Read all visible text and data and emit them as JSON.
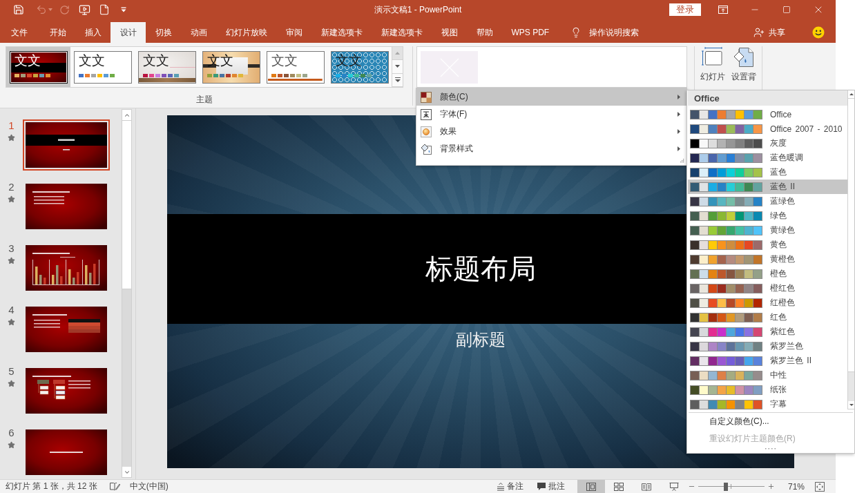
{
  "title_bar": {
    "quick_access": [
      {
        "kind": "save",
        "disabled": false
      },
      {
        "kind": "undo",
        "disabled": true
      },
      {
        "kind": "redo",
        "disabled": true
      },
      {
        "kind": "present",
        "disabled": false
      },
      {
        "kind": "new",
        "disabled": false
      },
      {
        "kind": "customize",
        "disabled": false
      }
    ],
    "title": "演示文稿1 - PowerPoint",
    "sign_in": "登录"
  },
  "ribbon_tabs": [
    {
      "label": "文件",
      "selected": false
    },
    {
      "label": "开始",
      "selected": false
    },
    {
      "label": "插入",
      "selected": false
    },
    {
      "label": "设计",
      "selected": true
    },
    {
      "label": "切换",
      "selected": false
    },
    {
      "label": "动画",
      "selected": false
    },
    {
      "label": "幻灯片放映",
      "selected": false
    },
    {
      "label": "审阅",
      "selected": false
    },
    {
      "label": "新建选项卡",
      "selected": false
    },
    {
      "label": "新建选项卡",
      "selected": false
    },
    {
      "label": "视图",
      "selected": false
    },
    {
      "label": "帮助",
      "selected": false
    },
    {
      "label": "WPS PDF",
      "selected": false
    }
  ],
  "tell_me": "操作说明搜索",
  "share": "共享",
  "ribbon": {
    "themes": {
      "items": [
        {
          "kind": "red-band",
          "sample": "文文",
          "selected": true,
          "swatches": [
            {
              "color": "#e5b35c"
            },
            {
              "color": "#a39c7c"
            },
            {
              "color": "#d9482c"
            },
            {
              "color": "#c7a53e"
            },
            {
              "color": "#6b9baf"
            },
            {
              "color": "#e38f31"
            }
          ]
        },
        {
          "kind": "office",
          "sample": "文文",
          "selected": false,
          "swatches": [
            {
              "color": "#4472c4"
            },
            {
              "color": "#ed7d31"
            },
            {
              "color": "#a5a5a5"
            },
            {
              "color": "#ffc000"
            },
            {
              "color": "#5b9bd5"
            },
            {
              "color": "#70ad47"
            }
          ]
        },
        {
          "kind": "paper",
          "sample": "文文",
          "selected": false,
          "swatches": [
            {
              "color": "#b8133e"
            },
            {
              "color": "#e2458c"
            },
            {
              "color": "#c77ce0"
            },
            {
              "color": "#7f4fb7"
            },
            {
              "color": "#5b66b7"
            },
            {
              "color": "#599fb4"
            }
          ]
        },
        {
          "kind": "wood",
          "sample": "文文",
          "selected": false,
          "swatches": [
            {
              "color": "#94a23a"
            },
            {
              "color": "#3a9a78"
            },
            {
              "color": "#4872a2"
            },
            {
              "color": "#b23a2e"
            },
            {
              "color": "#e0852f"
            },
            {
              "color": "#e0b83a"
            }
          ]
        },
        {
          "kind": "plain-bar",
          "sample": "文文",
          "selected": false,
          "swatches": [
            {
              "color": "#e07a14"
            },
            {
              "color": "#bf562b"
            },
            {
              "color": "#8b5439"
            },
            {
              "color": "#a08b5e"
            },
            {
              "color": "#c4bf86"
            },
            {
              "color": "#9ca68c"
            }
          ]
        },
        {
          "kind": "pattern",
          "sample": "文文",
          "selected": false,
          "swatches": [
            {
              "color": "#1cade4"
            },
            {
              "color": "#2683c6"
            },
            {
              "color": "#27ced7"
            },
            {
              "color": "#42ba97"
            },
            {
              "color": "#3e8853"
            },
            {
              "color": "#62a39f"
            }
          ]
        }
      ],
      "label": "主题"
    },
    "customize": [
      {
        "kind": "slide-size",
        "label": "幻灯片"
      },
      {
        "kind": "format-background",
        "label": "设置背"
      }
    ]
  },
  "variants_menu": [
    {
      "kind": "colors",
      "label": "颜色(C)",
      "selected": true
    },
    {
      "kind": "fonts",
      "label": "字体(F)",
      "selected": false
    },
    {
      "kind": "effects",
      "label": "效果",
      "selected": false
    },
    {
      "kind": "background",
      "label": "背景样式",
      "selected": false
    }
  ],
  "color_schemes": {
    "header": "Office",
    "items": [
      {
        "name": "Office",
        "selected": false,
        "swatches": [
          {
            "color": "#44546a"
          },
          {
            "color": "#e7e6e6"
          },
          {
            "color": "#4472c4"
          },
          {
            "color": "#ed7d31"
          },
          {
            "color": "#a5a5a5"
          },
          {
            "color": "#ffc000"
          },
          {
            "color": "#5b9bd5"
          },
          {
            "color": "#70ad47"
          }
        ]
      },
      {
        "name": "Office 2007 - 2010",
        "selected": false,
        "swatches": [
          {
            "color": "#1f497d"
          },
          {
            "color": "#eeece1"
          },
          {
            "color": "#4f81bd"
          },
          {
            "color": "#c0504d"
          },
          {
            "color": "#9bbb59"
          },
          {
            "color": "#8064a2"
          },
          {
            "color": "#4bacc6"
          },
          {
            "color": "#f79646"
          }
        ]
      },
      {
        "name": "灰度",
        "selected": false,
        "swatches": [
          {
            "color": "#000000"
          },
          {
            "color": "#f8f8f8"
          },
          {
            "color": "#dddddd"
          },
          {
            "color": "#b2b2b2"
          },
          {
            "color": "#969696"
          },
          {
            "color": "#808080"
          },
          {
            "color": "#5f5f5f"
          },
          {
            "color": "#4d4d4d"
          }
        ]
      },
      {
        "name": "蓝色暖调",
        "selected": false,
        "swatches": [
          {
            "color": "#242852"
          },
          {
            "color": "#acccea"
          },
          {
            "color": "#4a66ac"
          },
          {
            "color": "#629dd1"
          },
          {
            "color": "#297fd5"
          },
          {
            "color": "#7f8fa9"
          },
          {
            "color": "#5aa2ae"
          },
          {
            "color": "#9d90a0"
          }
        ]
      },
      {
        "name": "蓝色",
        "selected": false,
        "swatches": [
          {
            "color": "#17406d"
          },
          {
            "color": "#dbeff9"
          },
          {
            "color": "#0f6fc6"
          },
          {
            "color": "#009dd9"
          },
          {
            "color": "#0bd0d9"
          },
          {
            "color": "#10cf9b"
          },
          {
            "color": "#7cca62"
          },
          {
            "color": "#a5c249"
          }
        ]
      },
      {
        "name": "蓝色 II",
        "selected": true,
        "swatches": [
          {
            "color": "#335b74"
          },
          {
            "color": "#dfe3e5"
          },
          {
            "color": "#1cade4"
          },
          {
            "color": "#2683c6"
          },
          {
            "color": "#27ced7"
          },
          {
            "color": "#42ba97"
          },
          {
            "color": "#3e8853"
          },
          {
            "color": "#62a39f"
          }
        ]
      },
      {
        "name": "蓝绿色",
        "selected": false,
        "swatches": [
          {
            "color": "#373545"
          },
          {
            "color": "#cedbe6"
          },
          {
            "color": "#3494ba"
          },
          {
            "color": "#58b6c0"
          },
          {
            "color": "#75bda7"
          },
          {
            "color": "#7a8c8e"
          },
          {
            "color": "#84acb6"
          },
          {
            "color": "#2683c6"
          }
        ]
      },
      {
        "name": "绿色",
        "selected": false,
        "swatches": [
          {
            "color": "#455f51"
          },
          {
            "color": "#e3ded1"
          },
          {
            "color": "#549e39"
          },
          {
            "color": "#8ab833"
          },
          {
            "color": "#c0cf3a"
          },
          {
            "color": "#029676"
          },
          {
            "color": "#4ab5c4"
          },
          {
            "color": "#0989b1"
          }
        ]
      },
      {
        "name": "黄绿色",
        "selected": false,
        "swatches": [
          {
            "color": "#455f51"
          },
          {
            "color": "#e3ded1"
          },
          {
            "color": "#99cb38"
          },
          {
            "color": "#63a537"
          },
          {
            "color": "#37a76f"
          },
          {
            "color": "#44c1a3"
          },
          {
            "color": "#4eb3cf"
          },
          {
            "color": "#51c3f9"
          }
        ]
      },
      {
        "name": "黄色",
        "selected": false,
        "swatches": [
          {
            "color": "#39302a"
          },
          {
            "color": "#e5dedb"
          },
          {
            "color": "#ffca08"
          },
          {
            "color": "#f8931d"
          },
          {
            "color": "#ce8d3e"
          },
          {
            "color": "#ec7016"
          },
          {
            "color": "#e64823"
          },
          {
            "color": "#9c6a6a"
          }
        ]
      },
      {
        "name": "黄橙色",
        "selected": false,
        "swatches": [
          {
            "color": "#4e3b30"
          },
          {
            "color": "#fbeec9"
          },
          {
            "color": "#f0a22e"
          },
          {
            "color": "#a5644e"
          },
          {
            "color": "#b58b80"
          },
          {
            "color": "#c3986d"
          },
          {
            "color": "#a19574"
          },
          {
            "color": "#c17529"
          }
        ]
      },
      {
        "name": "橙色",
        "selected": false,
        "swatches": [
          {
            "color": "#637052"
          },
          {
            "color": "#ccddea"
          },
          {
            "color": "#e48312"
          },
          {
            "color": "#bd582c"
          },
          {
            "color": "#865640"
          },
          {
            "color": "#9b8357"
          },
          {
            "color": "#c2bc80"
          },
          {
            "color": "#94a088"
          }
        ]
      },
      {
        "name": "橙红色",
        "selected": false,
        "swatches": [
          {
            "color": "#696464"
          },
          {
            "color": "#e9e5dc"
          },
          {
            "color": "#d34817"
          },
          {
            "color": "#9b2d1f"
          },
          {
            "color": "#a28e6a"
          },
          {
            "color": "#956251"
          },
          {
            "color": "#918485"
          },
          {
            "color": "#855d5d"
          }
        ]
      },
      {
        "name": "红橙色",
        "selected": false,
        "swatches": [
          {
            "color": "#505046"
          },
          {
            "color": "#eeece1"
          },
          {
            "color": "#e84c22"
          },
          {
            "color": "#ffbd47"
          },
          {
            "color": "#b64926"
          },
          {
            "color": "#ff8427"
          },
          {
            "color": "#cc9900"
          },
          {
            "color": "#b22600"
          }
        ]
      },
      {
        "name": "红色",
        "selected": false,
        "swatches": [
          {
            "color": "#323232"
          },
          {
            "color": "#e5c243"
          },
          {
            "color": "#a5300f"
          },
          {
            "color": "#d55816"
          },
          {
            "color": "#e19825"
          },
          {
            "color": "#b19c7d"
          },
          {
            "color": "#7f5f52"
          },
          {
            "color": "#b27d49"
          }
        ]
      },
      {
        "name": "紫红色",
        "selected": false,
        "swatches": [
          {
            "color": "#454551"
          },
          {
            "color": "#d8d9dc"
          },
          {
            "color": "#e32d91"
          },
          {
            "color": "#c830cc"
          },
          {
            "color": "#4ea6dc"
          },
          {
            "color": "#4775e7"
          },
          {
            "color": "#8971e1"
          },
          {
            "color": "#d54773"
          }
        ]
      },
      {
        "name": "紫罗兰色",
        "selected": false,
        "swatches": [
          {
            "color": "#373545"
          },
          {
            "color": "#dcd8dc"
          },
          {
            "color": "#ad84c6"
          },
          {
            "color": "#8784c7"
          },
          {
            "color": "#5d739a"
          },
          {
            "color": "#6997af"
          },
          {
            "color": "#84acb6"
          },
          {
            "color": "#6f8183"
          }
        ]
      },
      {
        "name": "紫罗兰色 II",
        "selected": false,
        "swatches": [
          {
            "color": "#632e62"
          },
          {
            "color": "#eae5eb"
          },
          {
            "color": "#92278f"
          },
          {
            "color": "#9b57d3"
          },
          {
            "color": "#755dd9"
          },
          {
            "color": "#665eb8"
          },
          {
            "color": "#45a5ed"
          },
          {
            "color": "#5982db"
          }
        ]
      },
      {
        "name": "中性",
        "selected": false,
        "swatches": [
          {
            "color": "#775f55"
          },
          {
            "color": "#ebddc3"
          },
          {
            "color": "#94b6d2"
          },
          {
            "color": "#dd8047"
          },
          {
            "color": "#a5ab81"
          },
          {
            "color": "#d8b25c"
          },
          {
            "color": "#7ba79d"
          },
          {
            "color": "#968c8c"
          }
        ]
      },
      {
        "name": "纸张",
        "selected": false,
        "swatches": [
          {
            "color": "#444d26"
          },
          {
            "color": "#fefac9"
          },
          {
            "color": "#a5b592"
          },
          {
            "color": "#f3a447"
          },
          {
            "color": "#e7bc29"
          },
          {
            "color": "#d092a7"
          },
          {
            "color": "#9c85c0"
          },
          {
            "color": "#809ec2"
          }
        ]
      },
      {
        "name": "字幕",
        "selected": false,
        "swatches": [
          {
            "color": "#5e5e5e"
          },
          {
            "color": "#dddddd"
          },
          {
            "color": "#418ab3"
          },
          {
            "color": "#a6b727"
          },
          {
            "color": "#f69200"
          },
          {
            "color": "#838383"
          },
          {
            "color": "#fec306"
          },
          {
            "color": "#df5327"
          }
        ]
      }
    ],
    "actions": [
      {
        "label": "自定义颜色(C)...",
        "disabled": false
      },
      {
        "label": "重设幻灯片主题颜色(R)",
        "disabled": true
      }
    ]
  },
  "slides": [
    {
      "number": "1",
      "selected": true,
      "kind": "title"
    },
    {
      "number": "2",
      "selected": false,
      "kind": "bullets"
    },
    {
      "number": "3",
      "selected": false,
      "kind": "chart"
    },
    {
      "number": "4",
      "selected": false,
      "kind": "table"
    },
    {
      "number": "5",
      "selected": false,
      "kind": "diagram"
    },
    {
      "number": "6",
      "selected": false,
      "kind": "section"
    }
  ],
  "slide": {
    "title": "标题布局",
    "subtitle": "副标题"
  },
  "status_bar": {
    "slide_info": "幻灯片 第 1 张，共 12 张",
    "language": "中文(中国)",
    "notes": "备注",
    "comments": "批注",
    "views": [
      {
        "kind": "normal",
        "selected": true
      },
      {
        "kind": "sorter",
        "selected": false
      },
      {
        "kind": "reading",
        "selected": false
      },
      {
        "kind": "slideshow",
        "selected": false
      }
    ],
    "zoom": {
      "level": 0.42,
      "reading": "71%"
    }
  }
}
